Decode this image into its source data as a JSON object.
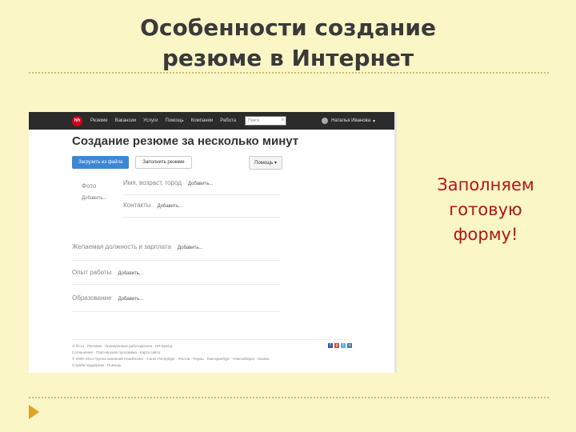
{
  "slide": {
    "title_line1": "Особенности создание",
    "title_line2": "резюме в Интернет",
    "note_line1": "Заполняем",
    "note_line2": "готовую",
    "note_line3": "форму!"
  },
  "screenshot": {
    "topbar": {
      "logo": "hh",
      "nav": [
        "Резюме",
        "Вакансии",
        "Услуги",
        "Помощь",
        "Компании",
        "Работа"
      ],
      "search_placeholder": "Поиск",
      "user_name": "Наталья Иванова"
    },
    "page_title": "Создание резюме за несколько минут",
    "buttons": {
      "from_file": "Загрузить из файла",
      "create": "Заполнить резюме",
      "help": "Помощь"
    },
    "photo": {
      "label": "Фото",
      "add": "Добавить..."
    },
    "rows": {
      "name": {
        "label": "Имя, возраст, город",
        "add": "Добавить..."
      },
      "contacts": {
        "label": "Контакты",
        "add": "Добавить..."
      },
      "position": {
        "label": "Желаемая должность и зарплата",
        "add": "Добавить..."
      },
      "experience": {
        "label": "Опыт работы",
        "add": "Добавить..."
      },
      "education": {
        "label": "Образование",
        "add": "Добавить..."
      }
    },
    "footer": {
      "line1": "О hh.ru · Реклама · Проверенные работодатели · HR-Бренд",
      "line2": "Соглашение · Партнёрская программа · Карта сайта",
      "line3": "© 2000–2014 Группа компаний HeadHunter · Санкт-Петербург · Ростов · Пермь · Екатеринбург · Новосибирск · Казань",
      "line4": "Служба поддержки · Помощь"
    },
    "social_icons": [
      "facebook-icon",
      "twitter-icon",
      "vk-icon",
      "mail-icon"
    ]
  },
  "colors": {
    "accent": "#3d86d4",
    "note": "#b01515",
    "logo": "#d0021b",
    "background": "#fbf6c6"
  }
}
